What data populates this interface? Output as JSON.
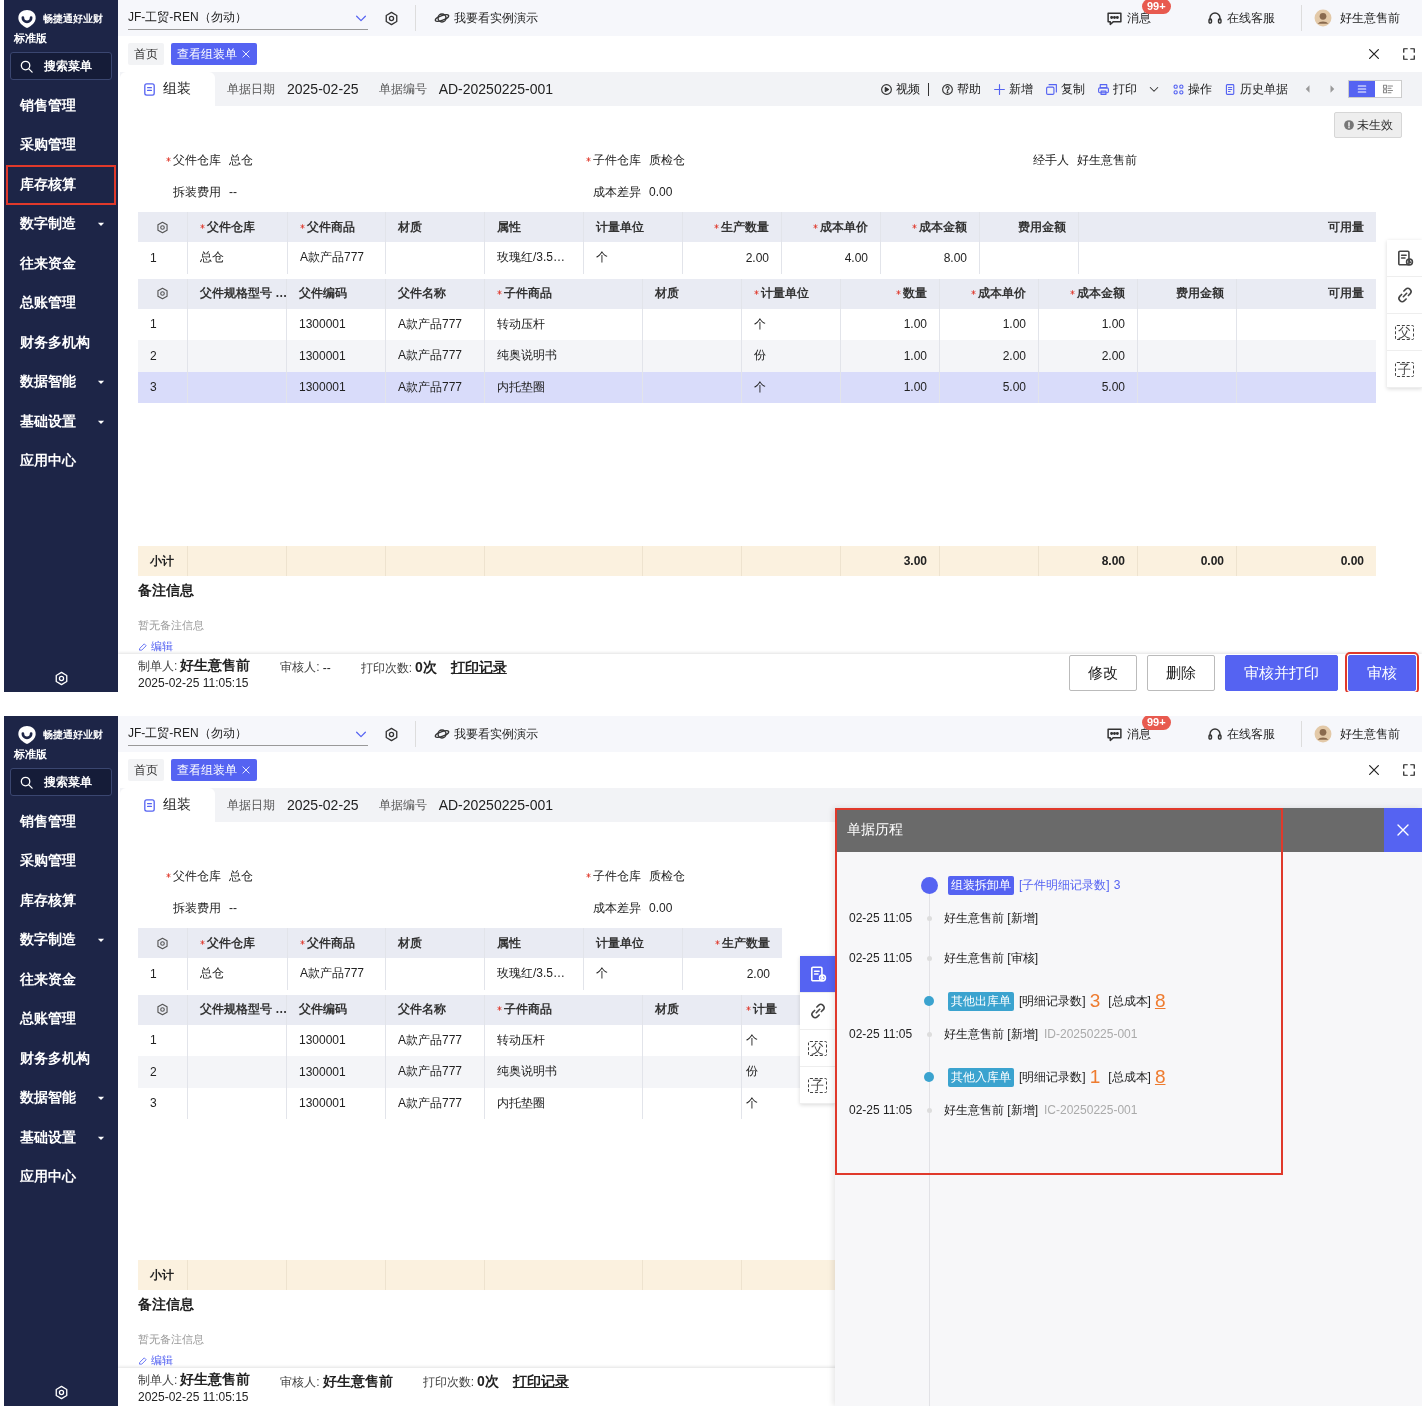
{
  "screens": [
    {
      "sidebar": {
        "brand": "畅捷通好业财",
        "edition": "标准版",
        "search": "搜索菜单",
        "items": [
          {
            "label": "销售管理",
            "has_submenu": false,
            "highlighted": false
          },
          {
            "label": "采购管理",
            "has_submenu": false,
            "highlighted": false
          },
          {
            "label": "库存核算",
            "has_submenu": false,
            "highlighted": true
          },
          {
            "label": "数字制造",
            "has_submenu": true,
            "highlighted": false
          },
          {
            "label": "往来资金",
            "has_submenu": false,
            "highlighted": false
          },
          {
            "label": "总账管理",
            "has_submenu": false,
            "highlighted": false
          },
          {
            "label": "财务多机构",
            "has_submenu": false,
            "highlighted": false
          },
          {
            "label": "数据智能",
            "has_submenu": true,
            "highlighted": false
          },
          {
            "label": "基础设置",
            "has_submenu": true,
            "highlighted": false
          },
          {
            "label": "应用中心",
            "has_submenu": false,
            "highlighted": false
          }
        ]
      },
      "topbar": {
        "company": "JF-工贸-REN（勿动）",
        "demo": "我要看实例演示",
        "messages": "消息",
        "badge": "99+",
        "service": "在线客服",
        "user": "好生意售前"
      },
      "tabs": [
        {
          "label": "首页",
          "selected": false,
          "closable": false
        },
        {
          "label": "查看组装单",
          "selected": true,
          "closable": true
        }
      ],
      "doc": {
        "type": "组装",
        "date_label": "单据日期",
        "date": "2025-02-25",
        "number_label": "单据编号",
        "number": "AD-20250225-001"
      },
      "toolbar": {
        "actions": [
          {
            "label": "视频",
            "dropdown": false
          },
          {
            "label": "帮助",
            "dropdown": false
          },
          {
            "label": "新增",
            "dropdown": false
          },
          {
            "label": "复制",
            "dropdown": false
          },
          {
            "label": "打印",
            "dropdown": true
          },
          {
            "label": "操作",
            "dropdown": false
          },
          {
            "label": "历史单据",
            "dropdown": false
          }
        ],
        "view_modes": [
          {
            "selected": true
          },
          {
            "selected": false
          }
        ]
      },
      "status": "未生效",
      "field_rows": [
        [
          {
            "label": "父件仓库",
            "value": "总仓",
            "required": true
          },
          {
            "label": "子件仓库",
            "value": "质检仓",
            "required": true
          },
          {
            "label": "经手人",
            "value": "好生意售前",
            "required": false
          }
        ],
        [
          {
            "label": "拆装费用",
            "value": "--",
            "required": false
          },
          {
            "label": "成本差异",
            "value": "0.00",
            "required": false
          }
        ]
      ],
      "parent_table": {
        "columns": [
          {
            "kind": "settings"
          },
          {
            "label": "父件仓库",
            "kind": "text",
            "required": true
          },
          {
            "label": "父件商品",
            "kind": "text",
            "required": true
          },
          {
            "label": "材质",
            "kind": "text",
            "required": false
          },
          {
            "label": "属性",
            "kind": "text",
            "required": false
          },
          {
            "label": "计量单位",
            "kind": "text",
            "required": false
          },
          {
            "label": "生产数量",
            "kind": "text",
            "required": true
          },
          {
            "label": "成本单价",
            "kind": "text",
            "required": true
          },
          {
            "label": "成本金额",
            "kind": "text",
            "required": true
          },
          {
            "label": "费用金额",
            "kind": "text",
            "required": false
          },
          {
            "label": "可用量",
            "kind": "text",
            "required": false
          }
        ],
        "rows": [
          {
            "selected": false,
            "cells": [
              "1",
              "总仓",
              "A款产品777",
              null,
              "玫瑰红/3.5…",
              "个",
              "2.00",
              "4.00",
              "8.00",
              null,
              null
            ]
          }
        ]
      },
      "child_table": {
        "columns": [
          {
            "kind": "settings"
          },
          {
            "label": "父件规格型号 …",
            "kind": "text",
            "required": false
          },
          {
            "label": "父件编码",
            "kind": "text",
            "required": false
          },
          {
            "label": "父件名称",
            "kind": "text",
            "required": false
          },
          {
            "label": "子件商品",
            "kind": "text",
            "required": true
          },
          {
            "label": "材质",
            "kind": "text",
            "required": false
          },
          {
            "label": "计量单位",
            "kind": "text",
            "required": true
          },
          {
            "label": "数量",
            "kind": "text",
            "required": true
          },
          {
            "label": "成本单价",
            "kind": "text",
            "required": true
          },
          {
            "label": "成本金额",
            "kind": "text",
            "required": true
          },
          {
            "label": "费用金额",
            "kind": "text",
            "required": false
          },
          {
            "label": "可用量",
            "kind": "text",
            "required": false
          }
        ],
        "rows": [
          {
            "selected": false,
            "cells": [
              "1",
              null,
              "1300001",
              "A款产品777",
              "转动压杆",
              null,
              "个",
              "1.00",
              "1.00",
              "1.00",
              null,
              null
            ]
          },
          {
            "selected": false,
            "cells": [
              "2",
              null,
              "1300001",
              "A款产品777",
              "纯奥说明书",
              null,
              "份",
              "1.00",
              "2.00",
              "2.00",
              null,
              null
            ]
          },
          {
            "selected": true,
            "cells": [
              "3",
              null,
              "1300001",
              "A款产品777",
              "内托垫圈",
              null,
              "个",
              "1.00",
              "5.00",
              "5.00",
              null,
              null
            ]
          }
        ]
      },
      "subtotal": {
        "cells": [
          "小计",
          null,
          null,
          null,
          null,
          null,
          null,
          "3.00",
          null,
          "8.00",
          "0.00",
          "0.00"
        ]
      },
      "notes": {
        "title": "备注信息",
        "text": "暂无备注信息",
        "edit": "编辑"
      },
      "footer": {
        "creator_label": "制单人:",
        "creator": "好生意售前",
        "created": "2025-02-25 11:05:15",
        "reviewer_label": "审核人:",
        "reviewer": "--",
        "print_label": "打印次数:",
        "print_count": "0次",
        "print_log": "打印记录",
        "buttons": [
          {
            "label": "修改",
            "kind": "default",
            "highlighted": false
          },
          {
            "label": "删除",
            "kind": "default",
            "highlighted": false
          },
          {
            "label": "审核并打印",
            "kind": "primary",
            "highlighted": false
          },
          {
            "label": "审核",
            "kind": "primary",
            "highlighted": true
          }
        ]
      },
      "side_tools": [
        {
          "kind": "history",
          "selected": false
        },
        {
          "kind": "link",
          "selected": false
        },
        {
          "kind": "glyph",
          "glyph": "父",
          "selected": false
        },
        {
          "kind": "glyph",
          "glyph": "子",
          "selected": false
        }
      ]
    },
    {
      "sidebar": {
        "brand": "畅捷通好业财",
        "edition": "标准版",
        "search": "搜索菜单",
        "items": [
          {
            "label": "销售管理",
            "has_submenu": false,
            "highlighted": false
          },
          {
            "label": "采购管理",
            "has_submenu": false,
            "highlighted": false
          },
          {
            "label": "库存核算",
            "has_submenu": false,
            "highlighted": false
          },
          {
            "label": "数字制造",
            "has_submenu": true,
            "highlighted": false
          },
          {
            "label": "往来资金",
            "has_submenu": false,
            "highlighted": false
          },
          {
            "label": "总账管理",
            "has_submenu": false,
            "highlighted": false
          },
          {
            "label": "财务多机构",
            "has_submenu": false,
            "highlighted": false
          },
          {
            "label": "数据智能",
            "has_submenu": true,
            "highlighted": false
          },
          {
            "label": "基础设置",
            "has_submenu": true,
            "highlighted": false
          },
          {
            "label": "应用中心",
            "has_submenu": false,
            "highlighted": false
          }
        ]
      },
      "topbar": {
        "company": "JF-工贸-REN（勿动）",
        "demo": "我要看实例演示",
        "messages": "消息",
        "badge": "99+",
        "service": "在线客服",
        "user": "好生意售前"
      },
      "tabs": [
        {
          "label": "首页",
          "selected": false,
          "closable": false
        },
        {
          "label": "查看组装单",
          "selected": true,
          "closable": true
        }
      ],
      "doc": {
        "type": "组装",
        "date_label": "单据日期",
        "date": "2025-02-25",
        "number_label": "单据编号",
        "number": "AD-20250225-001"
      },
      "field_rows": [
        [
          {
            "label": "父件仓库",
            "value": "总仓",
            "required": true
          },
          {
            "label": "子件仓库",
            "value": "质检仓",
            "required": true
          }
        ],
        [
          {
            "label": "拆装费用",
            "value": "--",
            "required": false
          },
          {
            "label": "成本差异",
            "value": "0.00",
            "required": false
          }
        ]
      ],
      "parent_table": {
        "columns": [
          {
            "kind": "settings"
          },
          {
            "label": "父件仓库",
            "kind": "text",
            "required": true
          },
          {
            "label": "父件商品",
            "kind": "text",
            "required": true
          },
          {
            "label": "材质",
            "kind": "text",
            "required": false
          },
          {
            "label": "属性",
            "kind": "text",
            "required": false
          },
          {
            "label": "计量单位",
            "kind": "text",
            "required": false
          },
          {
            "label": "生产数量",
            "kind": "text",
            "required": true
          }
        ],
        "rows": [
          {
            "selected": false,
            "cells": [
              "1",
              "总仓",
              "A款产品777",
              null,
              "玫瑰红/3.5…",
              "个",
              "2.00"
            ]
          }
        ]
      },
      "child_table": {
        "columns": [
          {
            "kind": "settings"
          },
          {
            "label": "父件规格型号 …",
            "kind": "text",
            "required": false
          },
          {
            "label": "父件编码",
            "kind": "text",
            "required": false
          },
          {
            "label": "父件名称",
            "kind": "text",
            "required": false
          },
          {
            "label": "子件商品",
            "kind": "text",
            "required": true
          },
          {
            "label": "材质",
            "kind": "text",
            "required": false
          },
          {
            "label": "计量",
            "kind": "text",
            "required": true
          }
        ],
        "rows": [
          {
            "selected": false,
            "cells": [
              "1",
              null,
              "1300001",
              "A款产品777",
              "转动压杆",
              null,
              "个"
            ]
          },
          {
            "selected": false,
            "cells": [
              "2",
              null,
              "1300001",
              "A款产品777",
              "纯奥说明书",
              null,
              "份"
            ]
          },
          {
            "selected": false,
            "cells": [
              "3",
              null,
              "1300001",
              "A款产品777",
              "内托垫圈",
              null,
              "个"
            ]
          }
        ]
      },
      "subtotal": {
        "cells": [
          "小计"
        ]
      },
      "notes": {
        "title": "备注信息",
        "text": "暂无备注信息",
        "edit": "编辑"
      },
      "footer": {
        "creator_label": "制单人:",
        "creator": "好生意售前",
        "created": "2025-02-25 11:05:15",
        "reviewer_label": "审核人:",
        "reviewer": "好生意售前",
        "print_label": "打印次数:",
        "print_count": "0次",
        "print_log": "打印记录"
      },
      "side_tools": [
        {
          "kind": "history",
          "selected": true
        },
        {
          "kind": "link",
          "selected": false
        },
        {
          "kind": "glyph",
          "glyph": "父",
          "selected": false
        },
        {
          "kind": "glyph",
          "glyph": "子",
          "selected": false
        }
      ],
      "history": {
        "title": "单据历程",
        "highlighted": true,
        "groups": [
          {
            "kind": "primary",
            "tag": "组装拆卸单",
            "color": "#5563f2",
            "details": [
              {
                "label": "[子件明细记录数]",
                "value": "3",
                "link": false
              }
            ],
            "records": [
              {
                "time": "02-25 11:05",
                "text": "好生意售前 [新增]"
              },
              {
                "time": "02-25 11:05",
                "text": "好生意售前 [审核]"
              }
            ]
          },
          {
            "kind": "related",
            "tag": "其他出库单",
            "color": "#3ba3cf",
            "details": [
              {
                "label": "[明细记录数]",
                "value": "3",
                "link": false
              },
              {
                "label": "[总成本]",
                "value": "8",
                "link": true
              }
            ],
            "records": [
              {
                "time": "02-25 11:05",
                "text": "好生意售前 [新增]",
                "doc": "ID-20250225-001"
              }
            ]
          },
          {
            "kind": "related",
            "tag": "其他入库单",
            "color": "#3ba3cf",
            "details": [
              {
                "label": "[明细记录数]",
                "value": "1",
                "link": false
              },
              {
                "label": "[总成本]",
                "value": "8",
                "link": true
              }
            ],
            "records": [
              {
                "time": "02-25 11:05",
                "text": "好生意售前 [新增]",
                "doc": "IC-20250225-001"
              }
            ]
          }
        ]
      }
    }
  ]
}
